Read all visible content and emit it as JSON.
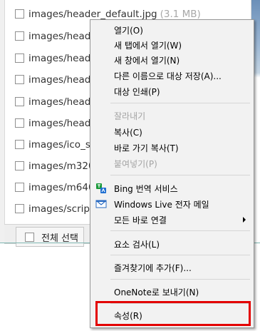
{
  "file_list": {
    "rows": [
      {
        "name": "images/header_default.jpg",
        "size": "(3.1 MB)"
      },
      {
        "name": "images/header"
      },
      {
        "name": "images/header"
      },
      {
        "name": "images/header"
      },
      {
        "name": "images/header"
      },
      {
        "name": "images/header"
      },
      {
        "name": "images/ico_sk"
      },
      {
        "name": "images/m320"
      },
      {
        "name": "images/m640"
      },
      {
        "name": "images/script"
      }
    ],
    "select_all_label": "전체 선택"
  },
  "context_menu": {
    "items": [
      {
        "label": "열기(O)"
      },
      {
        "label": "새 탭에서 열기(W)"
      },
      {
        "label": "새 창에서 열기(N)"
      },
      {
        "label": "다른 이름으로 대상 저장(A)..."
      },
      {
        "label": "대상 인쇄(P)"
      },
      {
        "label": "잘라내기",
        "disabled": true
      },
      {
        "label": "복사(C)"
      },
      {
        "label": "바로 가기 복사(T)"
      },
      {
        "label": "붙여넣기(P)",
        "disabled": true
      },
      {
        "label": "Bing 번역 서비스",
        "icon": "bing-translator-icon"
      },
      {
        "label": "Windows Live 전자 메일",
        "icon": "windows-live-mail-icon"
      },
      {
        "label": "모든 바로 연결",
        "submenu": true
      },
      {
        "label": "요소 검사(L)"
      },
      {
        "label": "즐겨찾기에 추가(F)..."
      },
      {
        "label": "OneNote로 보내기(N)"
      },
      {
        "label": "속성(R)",
        "highlighted": true
      }
    ]
  },
  "colors": {
    "highlight_border": "#e30000",
    "menu_background": "#f2f2f2",
    "disabled_text": "#a3a3a3"
  }
}
